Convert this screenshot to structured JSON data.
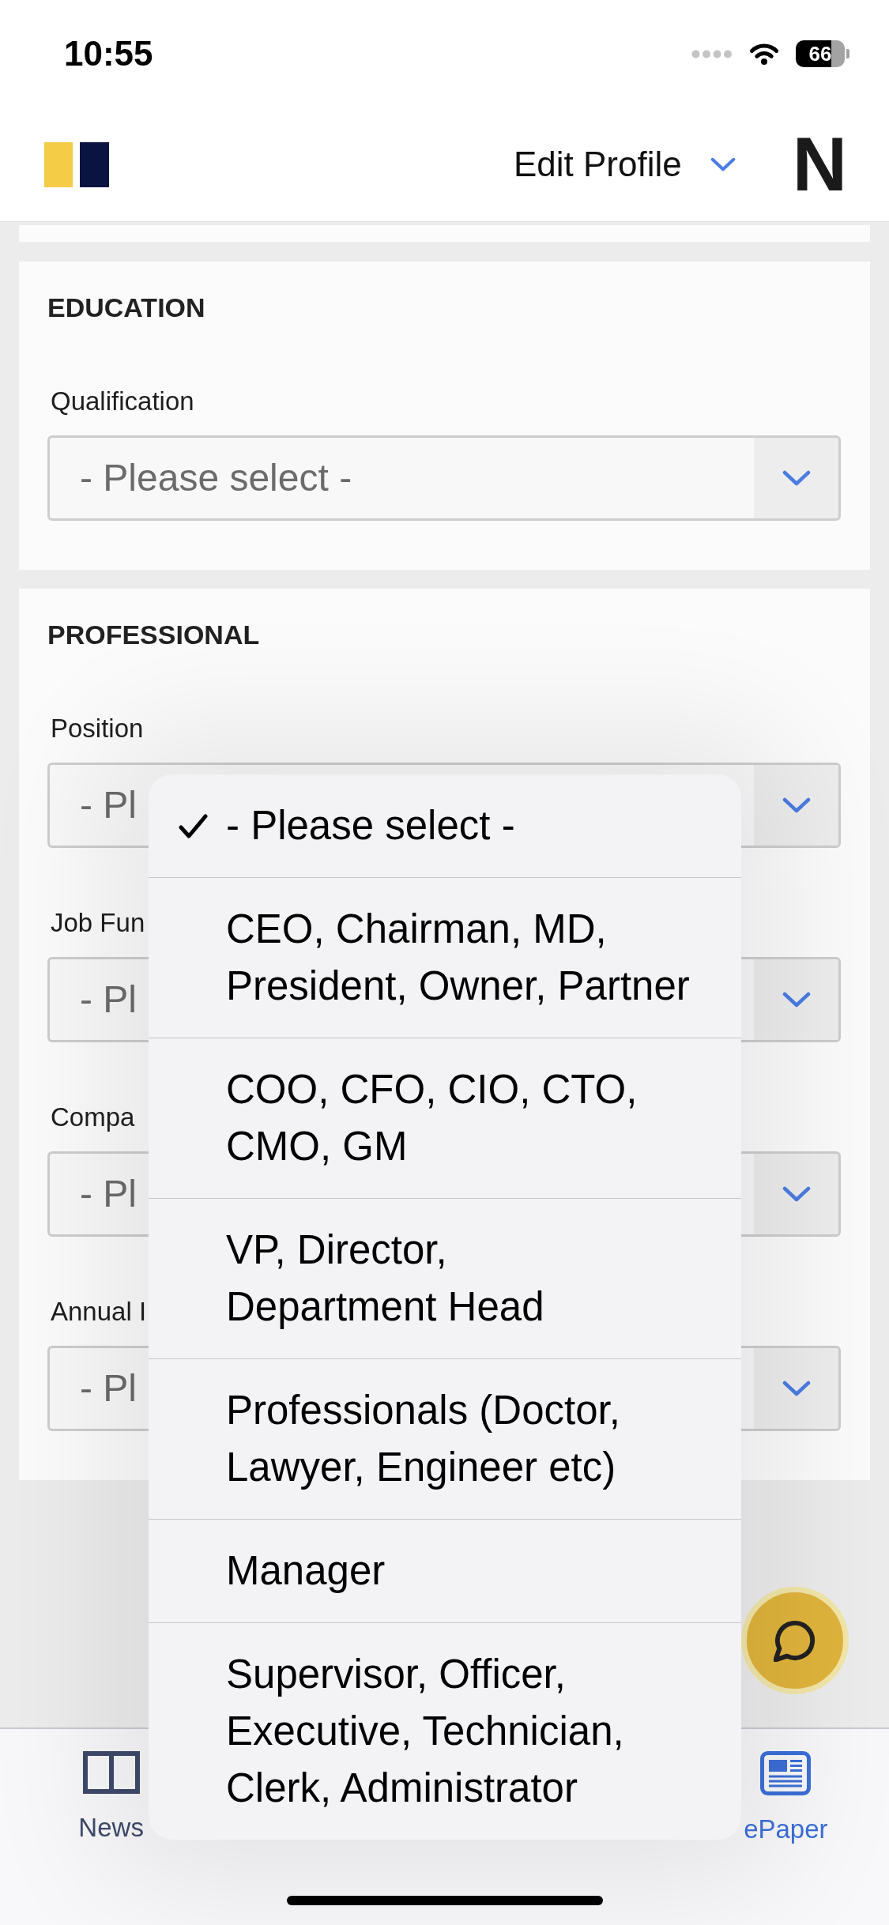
{
  "status_bar": {
    "time": "10:55",
    "battery": "66"
  },
  "header": {
    "menu_label": "Edit Profile",
    "logo_mark": "N"
  },
  "sections": [
    {
      "title": "EDUCATION",
      "fields": [
        {
          "label": "Qualification",
          "placeholder": "- Please select -"
        }
      ]
    },
    {
      "title": "PROFESSIONAL",
      "fields": [
        {
          "label": "Position",
          "placeholder": "- Pl"
        },
        {
          "label": "Job Fun",
          "placeholder": "- Pl"
        },
        {
          "label": "Compa",
          "placeholder": "- Pl"
        },
        {
          "label": "Annual I",
          "placeholder": "- Pl"
        }
      ]
    }
  ],
  "dropdown_menu": {
    "options": [
      {
        "label": "- Please select -",
        "selected": true
      },
      {
        "label": "CEO, Chairman, MD,\nPresident, Owner, Partner",
        "selected": false
      },
      {
        "label": "COO, CFO, CIO, CTO,\nCMO, GM",
        "selected": false
      },
      {
        "label": "VP, Director,\nDepartment Head",
        "selected": false
      },
      {
        "label": "Professionals (Doctor,\nLawyer, Engineer etc)",
        "selected": false
      },
      {
        "label": "Manager",
        "selected": false
      },
      {
        "label": "Supervisor, Officer,\nExecutive, Technician,\nClerk, Administrator",
        "selected": false
      }
    ]
  },
  "tab_bar": {
    "tabs": [
      {
        "label": "News",
        "selected": false
      },
      {
        "label": "ePaper",
        "selected": true
      }
    ]
  }
}
